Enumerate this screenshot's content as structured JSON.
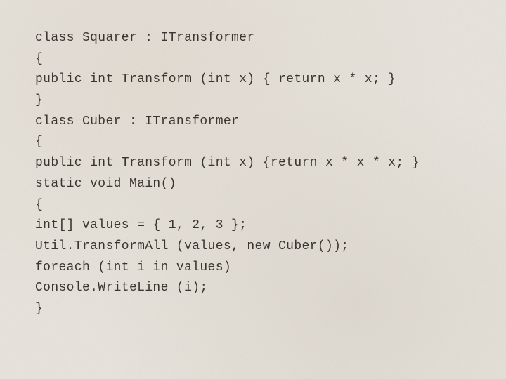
{
  "code": {
    "lines": [
      "class Squarer : ITransformer",
      "{",
      "public int Transform (int x) { return x * x; }",
      "}",
      "class Cuber : ITransformer",
      "{",
      "public int Transform (int x) {return x * x * x; }",
      "static void Main()",
      "{",
      "int[] values = { 1, 2, 3 };",
      "Util.TransformAll (values, new Cuber());",
      "foreach (int i in values)",
      "Console.WriteLine (i);",
      "}"
    ]
  }
}
